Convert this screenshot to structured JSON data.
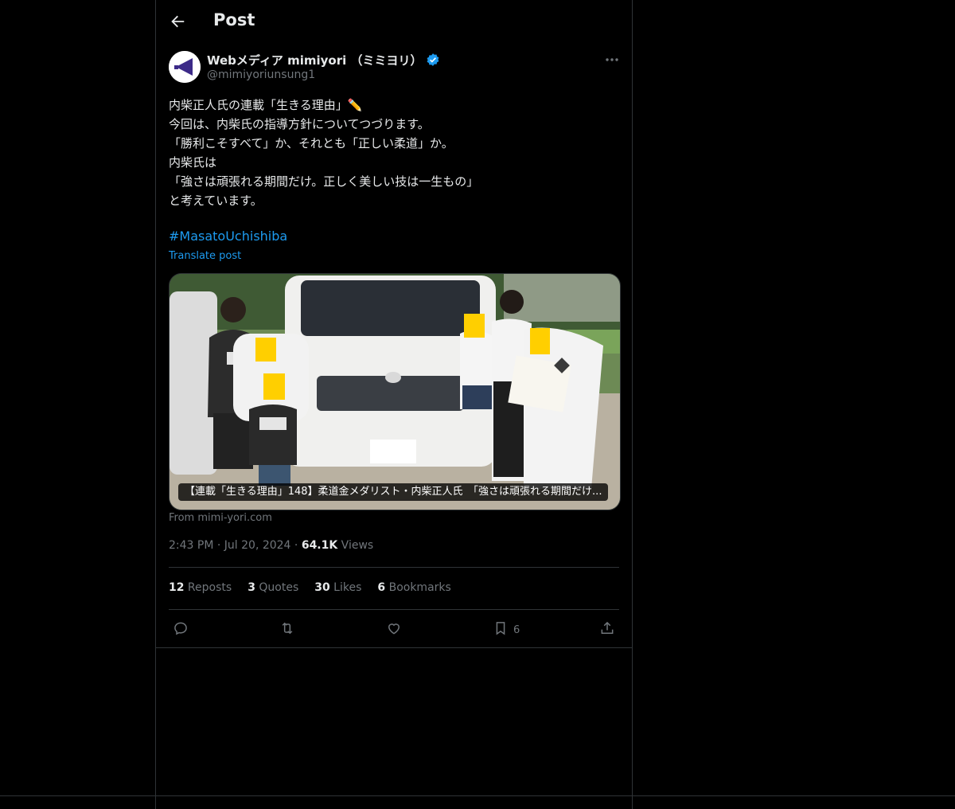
{
  "header": {
    "title": "Post"
  },
  "author": {
    "display_name": "Webメディア mimiyori （ミミヨリ）",
    "handle": "@mimiyoriunsung1",
    "verified_color": "#1d9bf0"
  },
  "tweet": {
    "lines": [
      "内柴正人氏の連載「生きる理由」✏️",
      "今回は、内柴氏の指導方針についてつづります。",
      "「勝利こそすべて」か、それとも「正しい柔道」か。",
      "内柴氏は",
      "「強さは頑張れる期間だけ。正しく美しい技は一生もの」",
      "と考えています。"
    ],
    "hashtag": "#MasatoUchishiba",
    "translate_label": "Translate post"
  },
  "card": {
    "caption": "【連載「生きる理由」148】柔道金メダリスト・内柴正人氏　「強さは頑張れる期間だけ...",
    "source": "From mimi-yori.com"
  },
  "meta": {
    "time": "2:43 PM",
    "sep1": " · ",
    "date": "Jul 20, 2024",
    "sep2": " · ",
    "views_count": "64.1K",
    "views_label": " Views"
  },
  "stats": {
    "reposts_count": "12",
    "reposts_label": " Reposts",
    "quotes_count": "3",
    "quotes_label": " Quotes",
    "likes_count": "30",
    "likes_label": " Likes",
    "bookmarks_count": "6",
    "bookmarks_label": " Bookmarks"
  },
  "actions": {
    "bookmark_count": "6",
    "icons": [
      "reply-icon",
      "repost-icon",
      "like-icon",
      "bookmark-icon",
      "share-icon"
    ]
  },
  "colors": {
    "accent": "#1d9bf0",
    "muted": "#71767b",
    "text": "#e7e9ea",
    "border": "#2f3336",
    "background": "#000000"
  }
}
